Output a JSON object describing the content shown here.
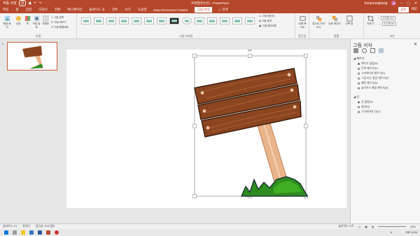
{
  "titlebar": {
    "autosave": "자동 저장",
    "autosave_state": "끔",
    "doc_title": "프레젠테이션1 - PowerPoint",
    "search_placeholder": "검색",
    "user": "hanyoungkang",
    "avatar": "HK"
  },
  "tabs": [
    "파일",
    "홈",
    "삽입",
    "디자인",
    "전환",
    "애니메이션",
    "슬라이드 쇼",
    "검토",
    "보기",
    "도움말",
    "Easy Document Creator",
    "그림 서식"
  ],
  "active_tab": "그림 서식",
  "menu_right": {
    "share": "공유",
    "comment": "메모"
  },
  "ribbon": {
    "adjust": {
      "remove_bg": "배경 제거",
      "corrections": "수정",
      "color": "색",
      "artistic": "꾸밈 효과",
      "transparency": "투명도",
      "compress": "그림 압축",
      "change": "그림 바꾸기",
      "reset": "그림 원래대로",
      "label": "조정"
    },
    "styles": {
      "label": "그림 스타일",
      "border": "그림 테두리",
      "effects": "그림 효과",
      "layout": "그림 레이아웃"
    },
    "accessibility": {
      "alt_text": "대체 텍스트",
      "label": "접근성"
    },
    "arrange": {
      "forward": "앞으로 가져오기",
      "backward": "뒤로 보내기",
      "selection_pane": "선택 창",
      "label": "정렬"
    },
    "size": {
      "crop": "자르기",
      "height": "10.89 cm",
      "width": "12.28 cm",
      "label": "크기"
    }
  },
  "slide_panel": {
    "number": "1"
  },
  "format_pane": {
    "title": "그림 서식",
    "fill_section": "채우기",
    "fill_options": [
      "채우기 없음(N)",
      "단색 채우기(S)",
      "그라데이션 채우기(G)",
      "그림 또는 질감 채우기(P)",
      "패턴 채우기(A)",
      "슬라이드 배경 채우기(B)"
    ],
    "fill_selected": 0,
    "line_section": "선",
    "line_options": [
      "선 없음(N)",
      "실선(S)",
      "그라데이션 선(G)"
    ],
    "line_selected": 0
  },
  "statusbar": {
    "slide_info": "슬라이드 1/1",
    "language": "한국어",
    "accessibility": "접근성: 조사 필요",
    "notes": "슬라이드 노트",
    "zoom": "83%"
  },
  "taskbar": {
    "time": "오후 10:54",
    "ime": "A"
  },
  "colors": {
    "accent": "#b7472a",
    "wood_dark": "#5b2d16",
    "wood": "#8b4521",
    "wood_light": "#a85a2c",
    "post": "#e9b48a",
    "grass": "#2e8b1e",
    "grass_light": "#3fae22"
  }
}
